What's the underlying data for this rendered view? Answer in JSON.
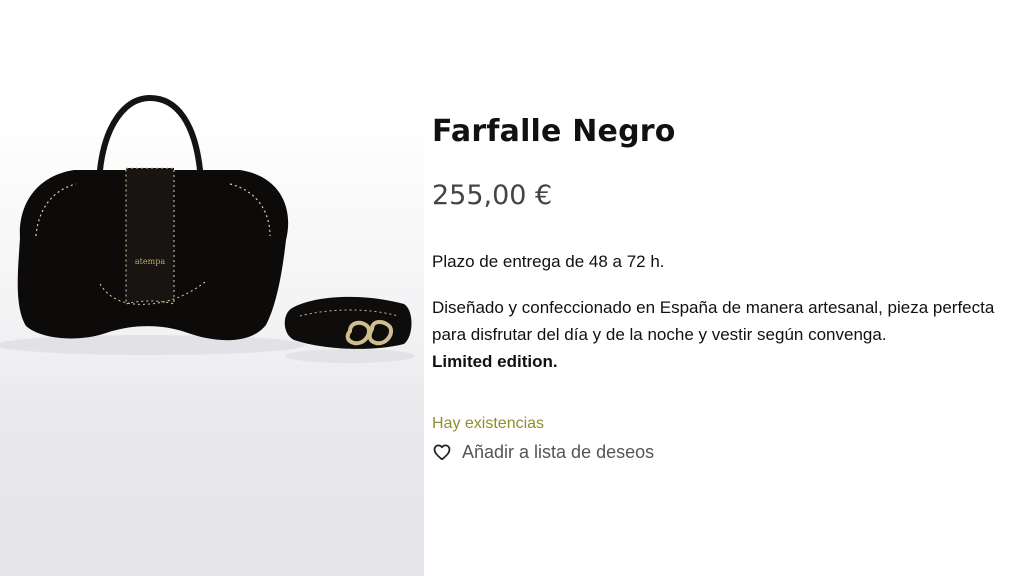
{
  "product": {
    "title": "Farfalle Negro",
    "price": "255,00 €",
    "delivery": "Plazo de entrega de 48 a 72 h.",
    "description": "Diseñado y confeccionado en España de manera artesanal, pieza perfecta para disfrutar del día y de la noche y vestir según convenga.",
    "edition": "Limited edition.",
    "stock_status": "Hay existencias",
    "wishlist_label": "Añadir a lista de deseos",
    "image_brand_mark": "atempa"
  },
  "icons": {
    "wishlist": "heart-icon"
  },
  "colors": {
    "stock": "#8d8f2a",
    "price": "#444444",
    "bag": "#0d0b0a",
    "stitching": "#d8cfa2"
  }
}
